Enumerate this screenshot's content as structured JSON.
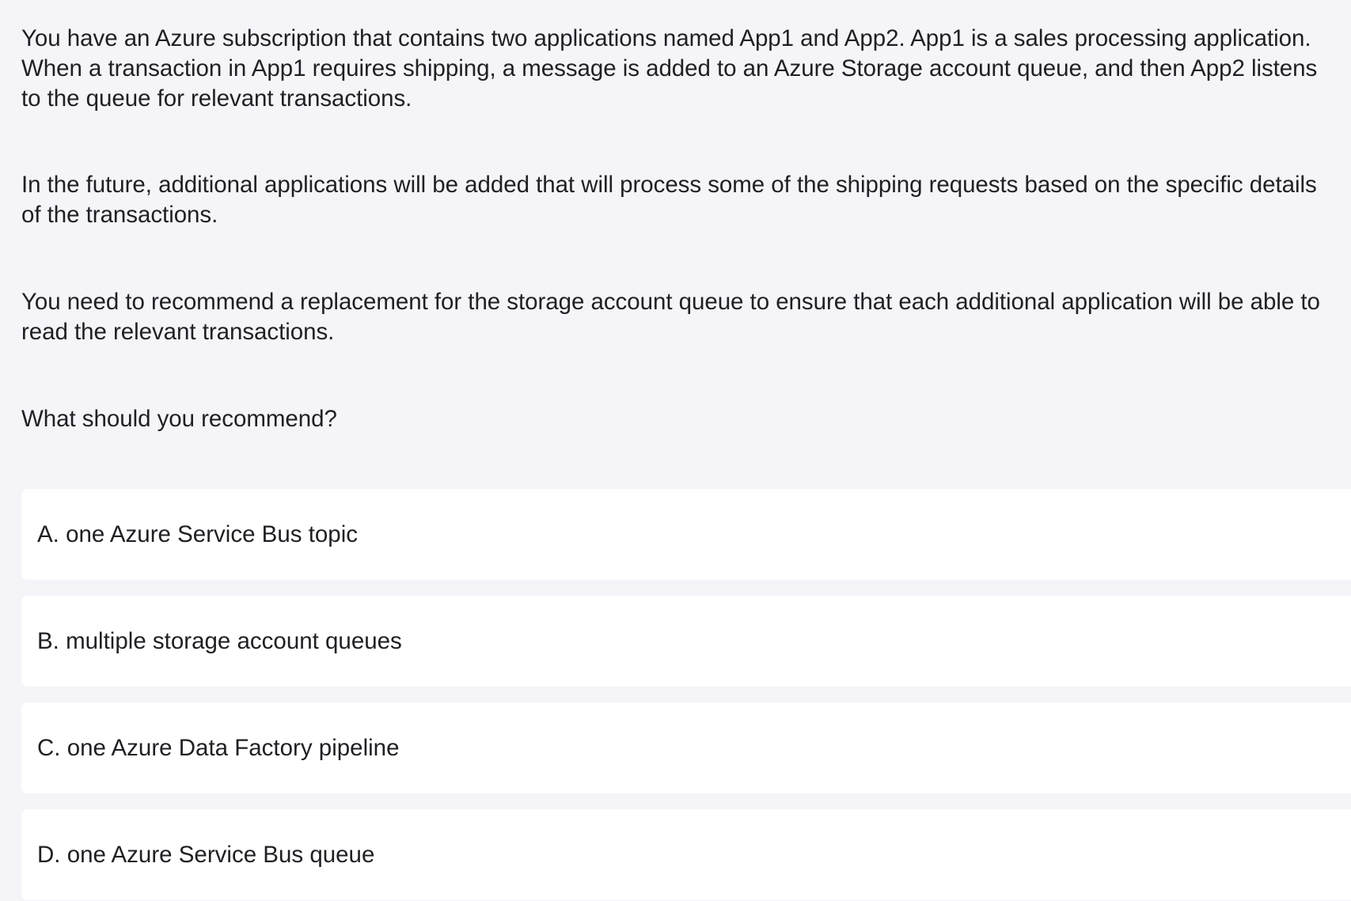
{
  "question": {
    "paragraphs": [
      "You have an Azure subscription that contains two applications named App1 and App2. App1 is a sales processing application. When a transaction in App1 requires shipping, a message is added to an Azure Storage account queue, and then App2 listens to the queue for relevant transactions.",
      "In the future, additional applications will be added that will process some of the shipping requests based on the specific details of the transactions.",
      "You need to recommend a replacement for the storage account queue to ensure that each additional application will be able to read the relevant transactions.",
      "What should you recommend?"
    ]
  },
  "options": [
    {
      "label": "A. one Azure Service Bus topic"
    },
    {
      "label": "B. multiple storage account queues"
    },
    {
      "label": "C. one Azure Data Factory pipeline"
    },
    {
      "label": "D. one Azure Service Bus queue"
    }
  ],
  "colors": {
    "background": "#f4f4f9",
    "option_background": "#ffffff",
    "text": "#1f1f24"
  }
}
